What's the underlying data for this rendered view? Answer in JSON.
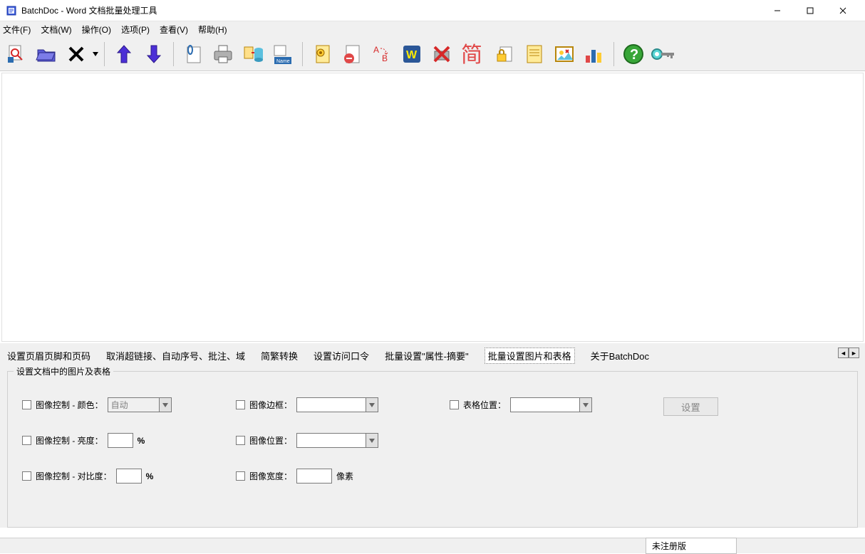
{
  "window": {
    "title": "BatchDoc - Word 文档批量处理工具"
  },
  "menubar": {
    "file": "文件(F)",
    "document": "文档(W)",
    "operate": "操作(O)",
    "options": "选项(P)",
    "view": "查看(V)",
    "help": "帮助(H)"
  },
  "toolbar_icons": {
    "i1": "magnify-doc-icon",
    "i2": "folder-open-icon",
    "i3": "delete-x-icon",
    "i4": "arrow-up-icon",
    "i5": "arrow-down-icon",
    "i6": "clip-doc-icon",
    "i7": "printer-icon",
    "i8": "convert-db-icon",
    "i9": "name-field-icon",
    "i10": "gear-doc-icon",
    "i11": "remove-page-icon",
    "i12": "ab-replace-icon",
    "i13": "word-w-icon",
    "i14": "cancel-print-icon",
    "i15": "simplified-icon",
    "i16": "lock-page-icon",
    "i17": "properties-icon",
    "i18": "picture-icon",
    "i19": "chart-bars-icon",
    "i20": "help-icon",
    "i21": "key-register-icon"
  },
  "tabs": {
    "header_footer": "设置页眉页脚和页码",
    "cancel_links": "取消超链接、自动序号、批注、域",
    "simp_trad": "简繁转换",
    "set_password": "设置访问口令",
    "batch_props": "批量设置\"属性-摘要\"",
    "batch_images": "批量设置图片和表格",
    "about": "关于BatchDoc"
  },
  "group": {
    "legend": "设置文档中的图片及表格"
  },
  "fields": {
    "img_color_label": "图像控制 - 颜色：",
    "img_color_value": "自动",
    "img_brightness_label": "图像控制 - 亮度：",
    "img_contrast_label": "图像控制 - 对比度：",
    "img_border_label": "图像边框：",
    "img_position_label": "图像位置：",
    "img_width_label": "图像宽度：",
    "table_position_label": "表格位置：",
    "percent": "%",
    "pixel_suffix": "像素",
    "set_button": "设置"
  },
  "status": {
    "unregistered": "未注册版"
  }
}
